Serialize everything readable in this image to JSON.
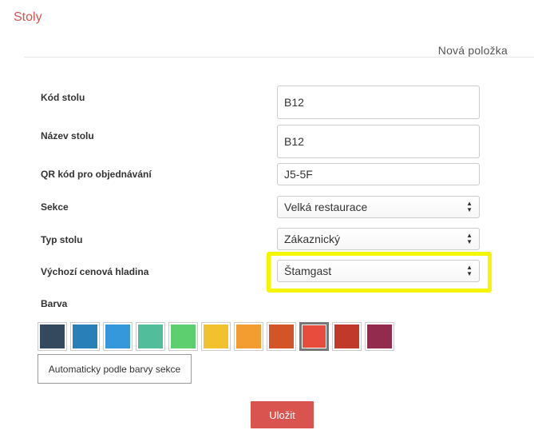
{
  "header": {
    "title": "Stoly",
    "tab_label": "Nová položka"
  },
  "form": {
    "table_code": {
      "label": "Kód stolu",
      "value": "B12"
    },
    "table_name": {
      "label": "Název stolu",
      "value": "B12"
    },
    "qr_code": {
      "label": "QR kód pro objednávání",
      "value": "J5-5F"
    },
    "section": {
      "label": "Sekce",
      "value": "Velká restaurace"
    },
    "table_type": {
      "label": "Typ stolu",
      "value": "Zákaznický"
    },
    "price_level": {
      "label": "Výchozí cenová hladina",
      "value": "Štamgast"
    },
    "color": {
      "label": "Barva",
      "swatches": [
        "#34495e",
        "#2980b9",
        "#3498db",
        "#52bd9b",
        "#5ecf6f",
        "#f2c12e",
        "#f39c2f",
        "#d35527",
        "#e74c3c",
        "#c0392b",
        "#922b4e"
      ],
      "selected_index": 8,
      "auto_label": "Automaticky podle barvy sekce"
    }
  },
  "actions": {
    "save_label": "Uložit"
  },
  "colors": {
    "accent": "#d9534f",
    "highlight": "#f5f500"
  }
}
